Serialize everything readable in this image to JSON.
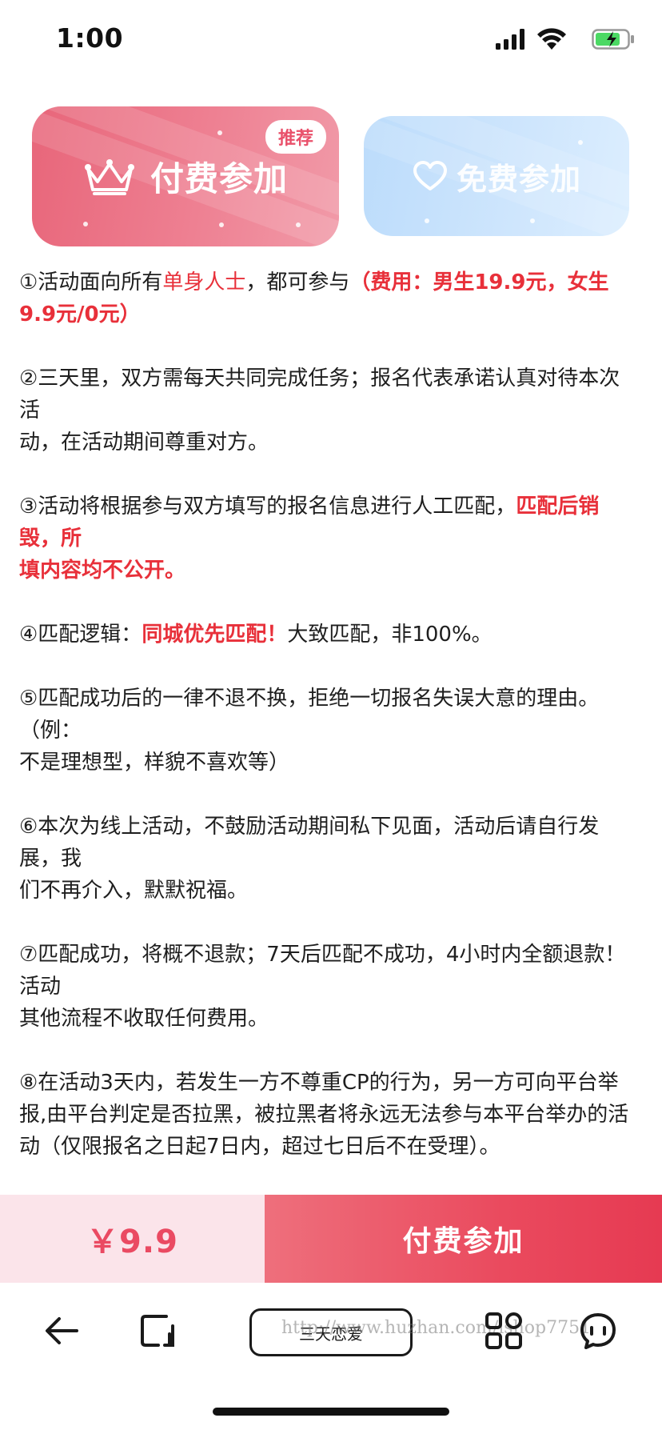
{
  "status_bar": {
    "time": "1:00"
  },
  "options": {
    "paid": {
      "label": "付费参加",
      "badge": "推荐",
      "icon": "crown-icon"
    },
    "free": {
      "label": "免费参加",
      "icon": "heart-icon"
    }
  },
  "rules": [
    {
      "parts": [
        {
          "text": "①活动面向所有"
        },
        {
          "text": "单身人士",
          "style": "red"
        },
        {
          "text": "，都可参与"
        },
        {
          "text": "（费用：男生19.9元，女生9.9元/0元）",
          "style": "red-b"
        }
      ]
    },
    {
      "parts": [
        {
          "text": "②三天里，双方需每天共同完成任务；报名代表承诺认真对待本次活\n动，在活动期间尊重对方。"
        }
      ]
    },
    {
      "parts": [
        {
          "text": "③活动将根据参与双方填写的报名信息进行人工匹配，"
        },
        {
          "text": "匹配后销毁，所\n填内容均不公开。",
          "style": "red-b"
        }
      ]
    },
    {
      "parts": [
        {
          "text": "④匹配逻辑："
        },
        {
          "text": "同城优先匹配！",
          "style": "red-b"
        },
        {
          "text": "大致匹配，非100%。"
        }
      ]
    },
    {
      "parts": [
        {
          "text": "⑤匹配成功后的一律不退不换，拒绝一切报名失误大意的理由。（例：\n不是理想型，样貌不喜欢等）"
        }
      ]
    },
    {
      "parts": [
        {
          "text": "⑥本次为线上活动，不鼓励活动期间私下见面，活动后请自行发展，我\n们不再介入，默默祝福。"
        }
      ]
    },
    {
      "parts": [
        {
          "text": "⑦匹配成功，将概不退款；7天后匹配不成功，4小时内全额退款！活动\n其他流程不收取任何费用。"
        }
      ]
    },
    {
      "parts": [
        {
          "text": "⑧在活动3天内，若发生一方不尊重CP的行为，另一方可向平台举报,由平台判定是否拉黑，被拉黑者将永远无法参与本平台举办的活动（仅限报名之日起7日内，超过七日后不在受理）。"
        }
      ]
    }
  ],
  "purchase": {
    "price": "￥9.9",
    "button_label": "付费参加"
  },
  "toolbar": {
    "tab_title": "三天恋爱",
    "watermark": "http://www.huzhan.com/ishop7751",
    "icons": [
      "back-arrow-icon",
      "tabs-icon",
      "apps-grid-icon",
      "chat-icon"
    ]
  },
  "colors": {
    "accent_red": "#e8303a",
    "paid_card": "#e8667a",
    "free_card": "#bcdcfb",
    "pay_button": "#ea4a5e",
    "price_bg": "#fbe4ea"
  }
}
